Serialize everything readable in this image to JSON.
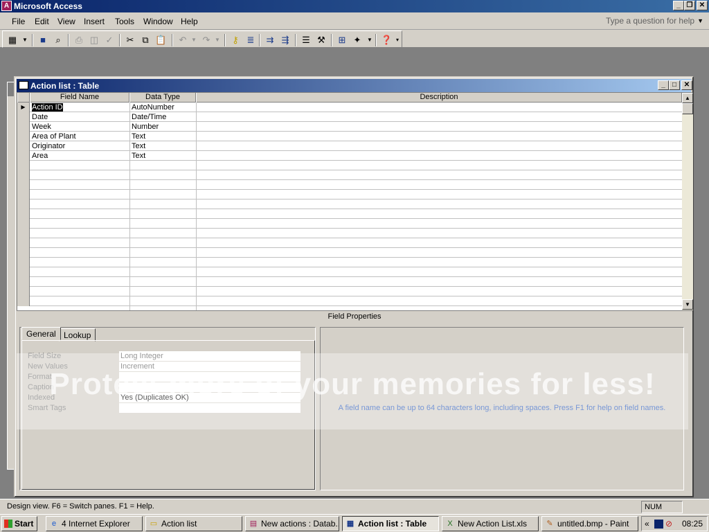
{
  "app": {
    "title": "Microsoft Access",
    "icon": "access-key-icon"
  },
  "menu": {
    "items": [
      "File",
      "Edit",
      "View",
      "Insert",
      "Tools",
      "Window",
      "Help"
    ],
    "ask_placeholder": "Type a question for help"
  },
  "toolbar": {
    "icons": [
      "view-design-icon",
      "save-icon",
      "search-icon",
      "print-icon",
      "print-preview-icon",
      "spelling-icon",
      "cut-icon",
      "copy-icon",
      "paste-icon",
      "undo-icon",
      "redo-icon",
      "primary-key-icon",
      "indexes-icon",
      "insert-rows-icon",
      "delete-rows-icon",
      "properties-icon",
      "build-icon",
      "database-window-icon",
      "new-object-icon",
      "help-icon"
    ]
  },
  "child": {
    "title": "Action list : Table",
    "columns": [
      "Field Name",
      "Data Type",
      "Description"
    ],
    "rows": [
      {
        "field": "Action ID",
        "type": "AutoNumber",
        "desc": ""
      },
      {
        "field": "Date",
        "type": "Date/Time",
        "desc": ""
      },
      {
        "field": "Week",
        "type": "Number",
        "desc": ""
      },
      {
        "field": "Area of Plant",
        "type": "Text",
        "desc": ""
      },
      {
        "field": "Originator",
        "type": "Text",
        "desc": ""
      },
      {
        "field": "Area",
        "type": "Text",
        "desc": ""
      }
    ]
  },
  "field_properties": {
    "header": "Field Properties",
    "tabs": [
      "General",
      "Lookup"
    ],
    "properties": [
      {
        "label": "Field Size",
        "value": "Long Integer"
      },
      {
        "label": "New Values",
        "value": "Increment"
      },
      {
        "label": "Format",
        "value": ""
      },
      {
        "label": "Caption",
        "value": ""
      },
      {
        "label": "Indexed",
        "value": "Yes (Duplicates OK)"
      },
      {
        "label": "Smart Tags",
        "value": ""
      }
    ],
    "help": "A field name can be up to 64 characters long, including spaces.  Press F1 for help on field names."
  },
  "watermark": "Protect more of your memories for less!",
  "status": {
    "text": "Design view.  F6 = Switch panes.  F1 = Help.",
    "num": "NUM"
  },
  "taskbar": {
    "start": "Start",
    "tasks": [
      {
        "label": "4 Internet Explorer",
        "icon": "internet-explorer-icon"
      },
      {
        "label": "Action list",
        "icon": "folder-icon"
      },
      {
        "label": "New actions : Datab...",
        "icon": "database-icon"
      },
      {
        "label": "Action list : Table",
        "icon": "table-icon"
      },
      {
        "label": "New Action List.xls",
        "icon": "excel-icon"
      },
      {
        "label": "untitled.bmp - Paint",
        "icon": "paint-icon"
      }
    ],
    "clock": "08:25"
  }
}
